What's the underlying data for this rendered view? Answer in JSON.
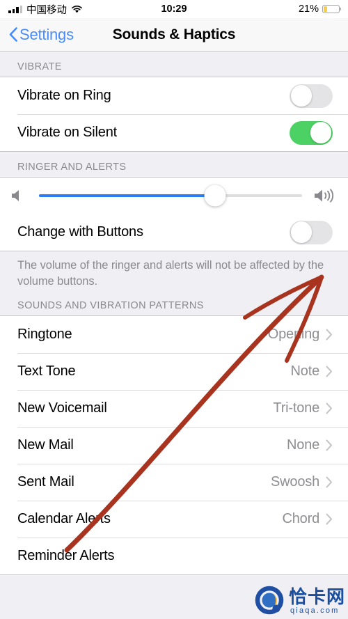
{
  "status_bar": {
    "carrier": "中国移动",
    "time": "10:29",
    "battery_percent": "21%",
    "battery_level": 21,
    "signal_bars_filled": 3,
    "signal_bars_total": 4,
    "wifi_icon": "wifi-icon",
    "battery_color": "#f7cf46"
  },
  "nav": {
    "back_label": "Settings",
    "back_icon": "chevron-left-icon",
    "title": "Sounds & Haptics",
    "back_color": "#4a8cf7"
  },
  "vibrate_section": {
    "header": "VIBRATE",
    "rows": [
      {
        "label": "Vibrate on Ring",
        "toggle": "off"
      },
      {
        "label": "Vibrate on Silent",
        "toggle": "on"
      }
    ]
  },
  "ringer_section": {
    "header": "RINGER AND ALERTS",
    "slider": {
      "low_icon": "speaker-low-icon",
      "high_icon": "speaker-high-icon",
      "value_percent": 67,
      "fill_color": "#2b7df5",
      "track_color": "#dedede"
    },
    "change_with_buttons": {
      "label": "Change with Buttons",
      "toggle": "off"
    },
    "footer_note": "The volume of the ringer and alerts will not be affected by the volume buttons."
  },
  "sounds_section": {
    "header": "SOUNDS AND VIBRATION PATTERNS",
    "rows": [
      {
        "label": "Ringtone",
        "value": "Opening"
      },
      {
        "label": "Text Tone",
        "value": "Note"
      },
      {
        "label": "New Voicemail",
        "value": "Tri-tone"
      },
      {
        "label": "New Mail",
        "value": "None"
      },
      {
        "label": "Sent Mail",
        "value": "Swoosh"
      },
      {
        "label": "Calendar Alerts",
        "value": "Chord"
      },
      {
        "label": "Reminder Alerts",
        "value": ""
      }
    ]
  },
  "annotation": {
    "type": "arrow",
    "color": "#a8341f",
    "points_to": "change-with-buttons-toggle"
  },
  "watermark": {
    "logo_icon": "qiaqa-logo-icon",
    "text_cn": "恰卡网",
    "text_en": "qiaqa.com",
    "color": "#1a4fa0"
  },
  "toggle_colors": {
    "on": "#4cd264",
    "off": "#e4e4e6"
  }
}
